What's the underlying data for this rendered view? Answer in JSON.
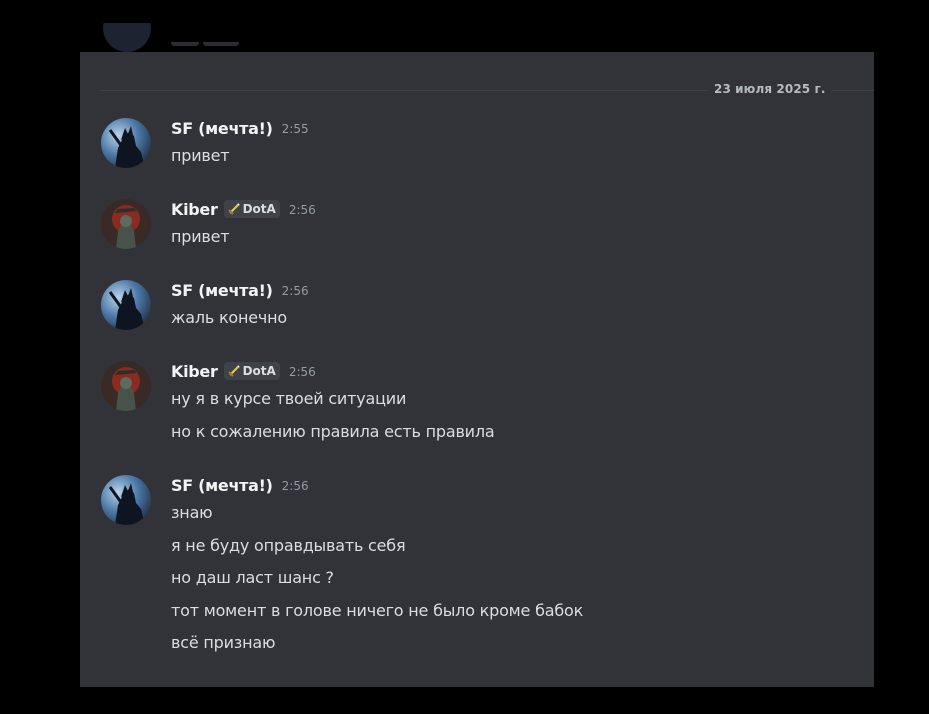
{
  "date_divider": "23 июля 2025 г.",
  "colors": {
    "background": "#313338",
    "text": "#dbdee1",
    "username": "#f2f3f5",
    "muted": "#949ba4"
  },
  "messages": [
    {
      "author": "SF (мечта!)",
      "tag": null,
      "time": "2:55",
      "lines": [
        "привет"
      ]
    },
    {
      "author": "Kiber",
      "tag": {
        "icon": "sword-icon",
        "label": "DotA"
      },
      "time": "2:56",
      "lines": [
        "привет"
      ]
    },
    {
      "author": "SF (мечта!)",
      "tag": null,
      "time": "2:56",
      "lines": [
        "жаль конечно"
      ]
    },
    {
      "author": "Kiber",
      "tag": {
        "icon": "sword-icon",
        "label": "DotA"
      },
      "time": "2:56",
      "lines": [
        "ну я в курсе твоей ситуации",
        "но к сожалению правила есть правила"
      ]
    },
    {
      "author": "SF (мечта!)",
      "tag": null,
      "time": "2:56",
      "lines": [
        "знаю",
        "я не буду оправдывать себя",
        "но даш ласт шанс ?",
        "тот момент в голове ничего не было кроме бабок",
        "всё признаю"
      ]
    }
  ]
}
